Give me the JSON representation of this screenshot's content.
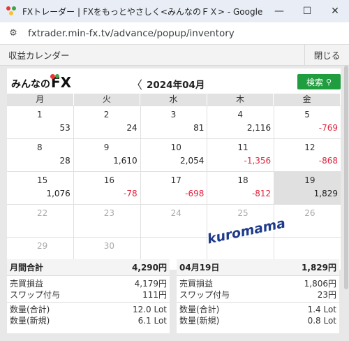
{
  "browser": {
    "title": "FXトレーダー | FXをもっとやさしく<みんなのＦＸ> - Google Chrome",
    "url": "fxtrader.min-fx.tv/advance/popup/inventory",
    "minimize_icon": "minimize-icon",
    "maximize_icon": "maximize-icon",
    "close_icon": "close-icon"
  },
  "app": {
    "title": "収益カレンダー",
    "close_label": "閉じる"
  },
  "logo": {
    "jp": "みんなの",
    "fx": "FX"
  },
  "nav": {
    "prev": "〈",
    "month": "2024年04月",
    "search_label": "検索",
    "search_icon": "search-icon"
  },
  "weekdays": [
    "月",
    "火",
    "水",
    "木",
    "金"
  ],
  "weeks": [
    [
      {
        "day": "1",
        "value": "53",
        "neg": false
      },
      {
        "day": "2",
        "value": "24",
        "neg": false
      },
      {
        "day": "3",
        "value": "81",
        "neg": false
      },
      {
        "day": "4",
        "value": "2,116",
        "neg": false
      },
      {
        "day": "5",
        "value": "-769",
        "neg": true
      }
    ],
    [
      {
        "day": "8",
        "value": "28",
        "neg": false
      },
      {
        "day": "9",
        "value": "1,610",
        "neg": false
      },
      {
        "day": "10",
        "value": "2,054",
        "neg": false
      },
      {
        "day": "11",
        "value": "-1,356",
        "neg": true
      },
      {
        "day": "12",
        "value": "-868",
        "neg": true
      }
    ],
    [
      {
        "day": "15",
        "value": "1,076",
        "neg": false
      },
      {
        "day": "16",
        "value": "-78",
        "neg": true
      },
      {
        "day": "17",
        "value": "-698",
        "neg": true
      },
      {
        "day": "18",
        "value": "-812",
        "neg": true
      },
      {
        "day": "19",
        "value": "1,829",
        "neg": false,
        "selected": true
      }
    ],
    [
      {
        "day": "22",
        "value": "",
        "future": true
      },
      {
        "day": "23",
        "value": "",
        "future": true
      },
      {
        "day": "24",
        "value": "",
        "future": true
      },
      {
        "day": "25",
        "value": "",
        "future": true
      },
      {
        "day": "26",
        "value": "",
        "future": true
      }
    ],
    [
      {
        "day": "29",
        "value": "",
        "future": true
      },
      {
        "day": "30",
        "value": "",
        "future": true
      },
      {
        "day": "",
        "value": ""
      },
      {
        "day": "",
        "value": ""
      },
      {
        "day": "",
        "value": ""
      }
    ]
  ],
  "watermark": "kuromama",
  "monthly": {
    "title": "月間合計",
    "total": "4,290円",
    "pl_label": "売買損益",
    "pl": "4,179円",
    "swap_label": "スワップ付与",
    "swap": "111円",
    "qty_total_label": "数量(合計)",
    "qty_total": "12.0 Lot",
    "qty_new_label": "数量(新規)",
    "qty_new": "6.1 Lot"
  },
  "daily": {
    "title": "04月19日",
    "total": "1,829円",
    "pl_label": "売買損益",
    "pl": "1,806円",
    "swap_label": "スワップ付与",
    "swap": "23円",
    "qty_total_label": "数量(合計)",
    "qty_total": "1.4 Lot",
    "qty_new_label": "数量(新規)",
    "qty_new": "0.8 Lot"
  },
  "colors": {
    "accent_green": "#1f9d3f",
    "negative": "#e0243c",
    "selected_cell": "#e0e0e0"
  }
}
